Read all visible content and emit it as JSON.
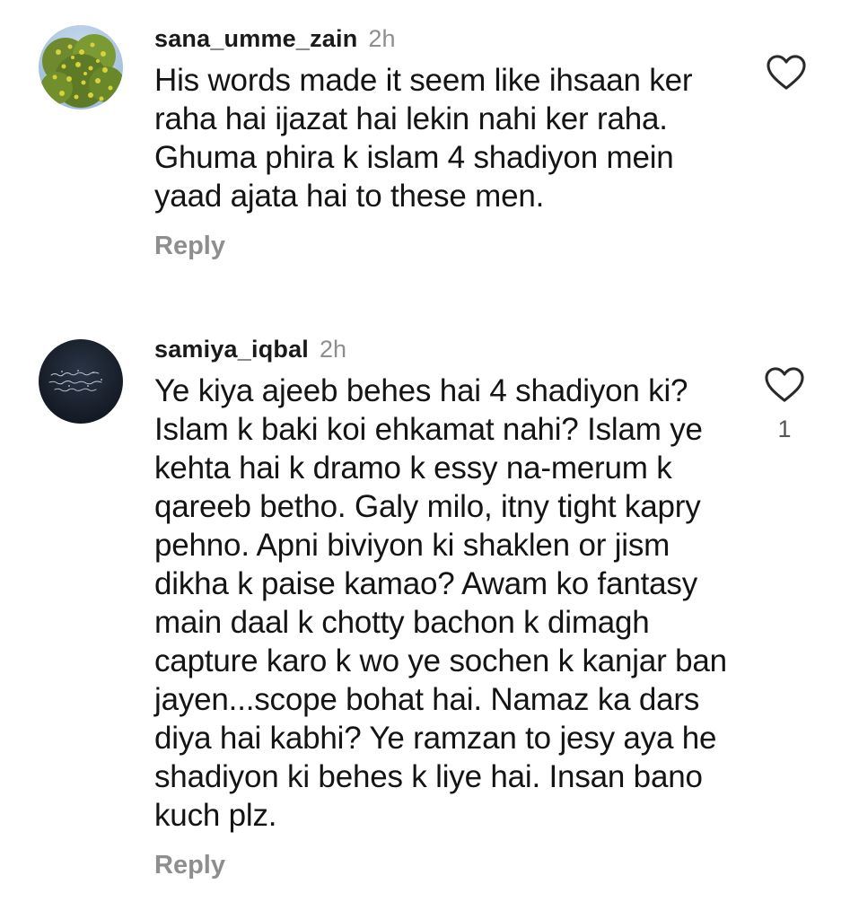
{
  "comments": [
    {
      "username": "sana_umme_zain",
      "time": "2h",
      "text": "His words made it seem like ihsaan ker raha hai ijazat hai lekin nahi ker raha. Ghuma phira k islam 4 shadiyon mein yaad ajata hai to these men.",
      "reply_label": "Reply",
      "avatar_icon": "flowering-tree-avatar",
      "like_icon": "heart-outline-icon",
      "like_count": ""
    },
    {
      "username": "samiya_iqbal",
      "time": "2h",
      "text": "Ye kiya ajeeb behes hai 4 shadiyon ki? Islam k baki koi ehkamat nahi? Islam ye kehta hai k dramo k essy na-merum k qareeb betho. Galy milo, itny tight kapry pehno. Apni biviyon ki shaklen or jism dikha k paise kamao? Awam ko fantasy main daal k chotty bachon k dimagh capture karo k wo ye sochen k kanjar ban jayen...scope bohat hai. Namaz ka dars diya hai kabhi? Ye ramzan to jesy aya he shadiyon ki behes k liye hai. Insan bano kuch plz.",
      "reply_label": "Reply",
      "avatar_icon": "dark-calligraphy-avatar",
      "like_icon": "heart-outline-icon",
      "like_count": "1"
    }
  ],
  "colors": {
    "text": "#141414",
    "muted": "#8e8e8e",
    "background": "#ffffff"
  }
}
